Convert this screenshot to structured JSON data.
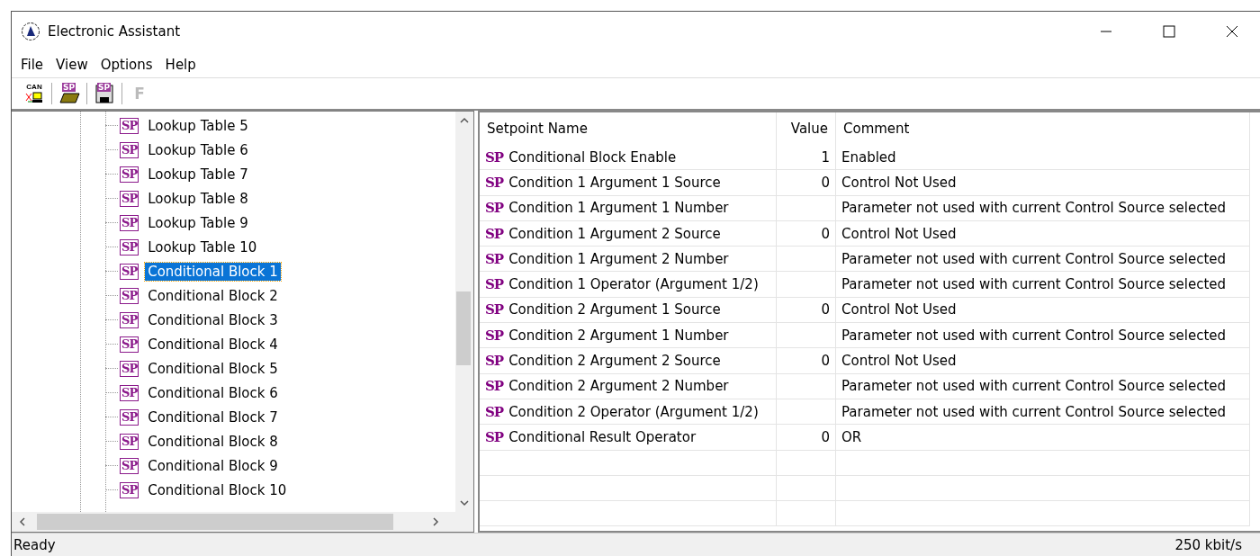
{
  "window": {
    "title": "Electronic Assistant"
  },
  "menu": [
    "File",
    "View",
    "Options",
    "Help"
  ],
  "toolbar": [
    {
      "kind": "can",
      "label": "CAN",
      "disabled": false
    },
    {
      "kind": "open",
      "label": "SP",
      "disabled": false
    },
    {
      "kind": "save",
      "label": "SP",
      "disabled": false
    },
    {
      "kind": "f",
      "label": "F",
      "disabled": true
    }
  ],
  "tree": {
    "items": [
      {
        "badge": "SP",
        "label": "Lookup Table 5",
        "selected": false
      },
      {
        "badge": "SP",
        "label": "Lookup Table 6",
        "selected": false
      },
      {
        "badge": "SP",
        "label": "Lookup Table 7",
        "selected": false
      },
      {
        "badge": "SP",
        "label": "Lookup Table 8",
        "selected": false
      },
      {
        "badge": "SP",
        "label": "Lookup Table 9",
        "selected": false
      },
      {
        "badge": "SP",
        "label": "Lookup Table 10",
        "selected": false
      },
      {
        "badge": "SP",
        "label": "Conditional Block 1",
        "selected": true
      },
      {
        "badge": "SP",
        "label": "Conditional Block 2",
        "selected": false
      },
      {
        "badge": "SP",
        "label": "Conditional Block 3",
        "selected": false
      },
      {
        "badge": "SP",
        "label": "Conditional Block 4",
        "selected": false
      },
      {
        "badge": "SP",
        "label": "Conditional Block 5",
        "selected": false
      },
      {
        "badge": "SP",
        "label": "Conditional Block 6",
        "selected": false
      },
      {
        "badge": "SP",
        "label": "Conditional Block 7",
        "selected": false
      },
      {
        "badge": "SP",
        "label": "Conditional Block 8",
        "selected": false
      },
      {
        "badge": "SP",
        "label": "Conditional Block 9",
        "selected": false
      },
      {
        "badge": "SP",
        "label": "Conditional Block 10",
        "selected": false
      }
    ]
  },
  "table": {
    "columns": [
      "Setpoint Name",
      "Value",
      "Comment"
    ],
    "rows": [
      {
        "tag": "SP",
        "name": "Conditional Block Enable",
        "value": "1",
        "comment": "Enabled"
      },
      {
        "tag": "SP",
        "name": "Condition 1 Argument 1 Source",
        "value": "0",
        "comment": "Control Not Used"
      },
      {
        "tag": "SP",
        "name": "Condition 1 Argument 1 Number",
        "comment": "Parameter not used with current Control Source selected"
      },
      {
        "tag": "SP",
        "name": "Condition 1 Argument 2 Source",
        "value": "0",
        "comment": "Control Not Used"
      },
      {
        "tag": "SP",
        "name": "Condition 1 Argument 2 Number",
        "comment": "Parameter not used with current Control Source selected"
      },
      {
        "tag": "SP",
        "name": "Condition 1 Operator (Argument 1/2)",
        "comment": "Parameter not used with current Control Source selected"
      },
      {
        "tag": "SP",
        "name": "Condition 2 Argument 1 Source",
        "value": "0",
        "comment": "Control Not Used"
      },
      {
        "tag": "SP",
        "name": "Condition 2 Argument 1 Number",
        "comment": "Parameter not used with current Control Source selected"
      },
      {
        "tag": "SP",
        "name": "Condition 2 Argument 2 Source",
        "value": "0",
        "comment": "Control Not Used"
      },
      {
        "tag": "SP",
        "name": "Condition 2 Argument 2 Number",
        "comment": "Parameter not used with current Control Source selected"
      },
      {
        "tag": "SP",
        "name": "Condition 2 Operator (Argument 1/2)",
        "comment": "Parameter not used with current Control Source selected"
      },
      {
        "tag": "SP",
        "name": "Conditional Result Operator",
        "value": "0",
        "comment": "OR"
      }
    ]
  },
  "status_bar": {
    "message": "Ready",
    "baud": "250 kbit/s"
  }
}
